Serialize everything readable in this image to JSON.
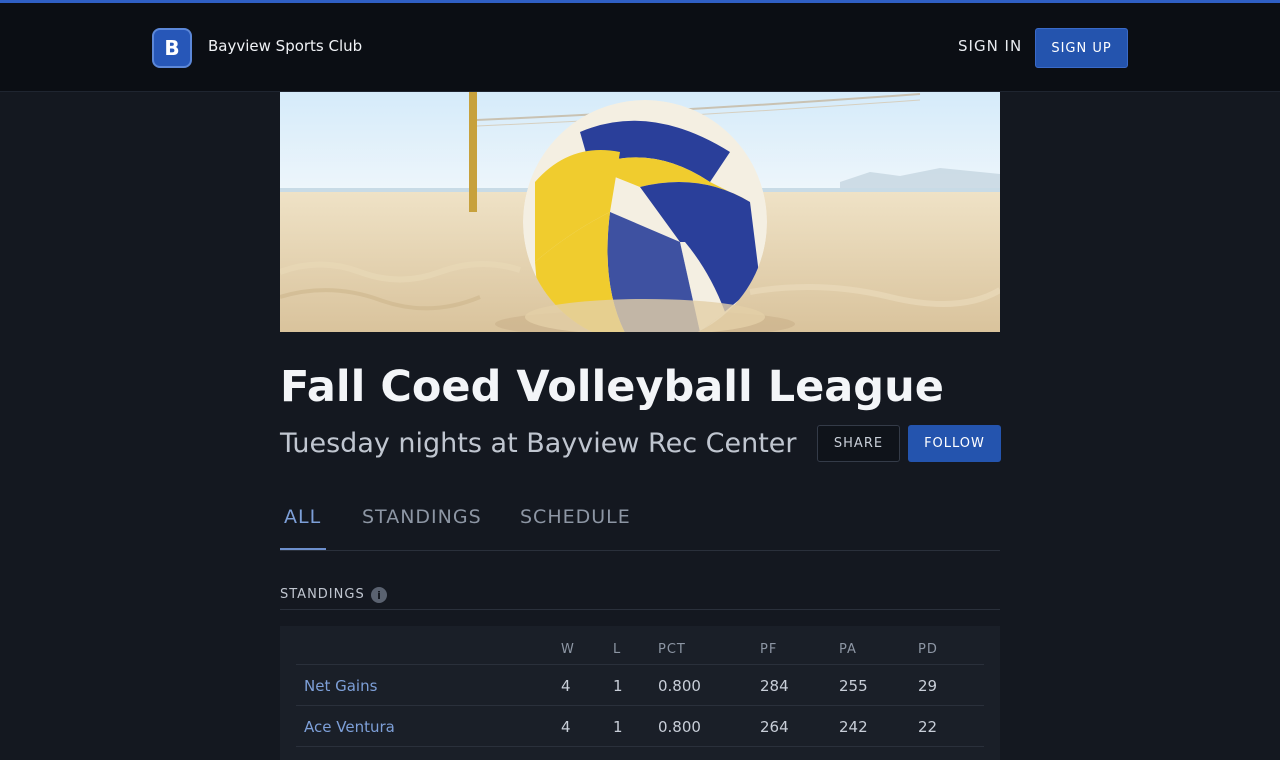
{
  "header": {
    "logo_letter": "B",
    "brand": "Bayview Sports Club",
    "signin_label": "SIGN IN",
    "signup_label": "SIGN UP"
  },
  "page": {
    "title": "Fall Coed Volleyball League",
    "subtitle": "Tuesday nights at Bayview Rec Center",
    "share_label": "SHARE",
    "follow_label": "FOLLOW"
  },
  "tabs": [
    {
      "label": "ALL",
      "active": true
    },
    {
      "label": "STANDINGS",
      "active": false
    },
    {
      "label": "SCHEDULE",
      "active": false
    }
  ],
  "standings": {
    "section_label": "STANDINGS",
    "info_glyph": "i",
    "columns": [
      "W",
      "L",
      "PCT",
      "PF",
      "PA",
      "PD"
    ],
    "rows": [
      {
        "team": "Net Gains",
        "w": "4",
        "l": "1",
        "pct": "0.800",
        "pf": "284",
        "pa": "255",
        "pd": "29"
      },
      {
        "team": "Ace Ventura",
        "w": "4",
        "l": "1",
        "pct": "0.800",
        "pf": "264",
        "pa": "242",
        "pd": "22"
      }
    ]
  },
  "colors": {
    "accent": "#2454ae",
    "link": "#7d9fd8",
    "background": "#141820"
  }
}
